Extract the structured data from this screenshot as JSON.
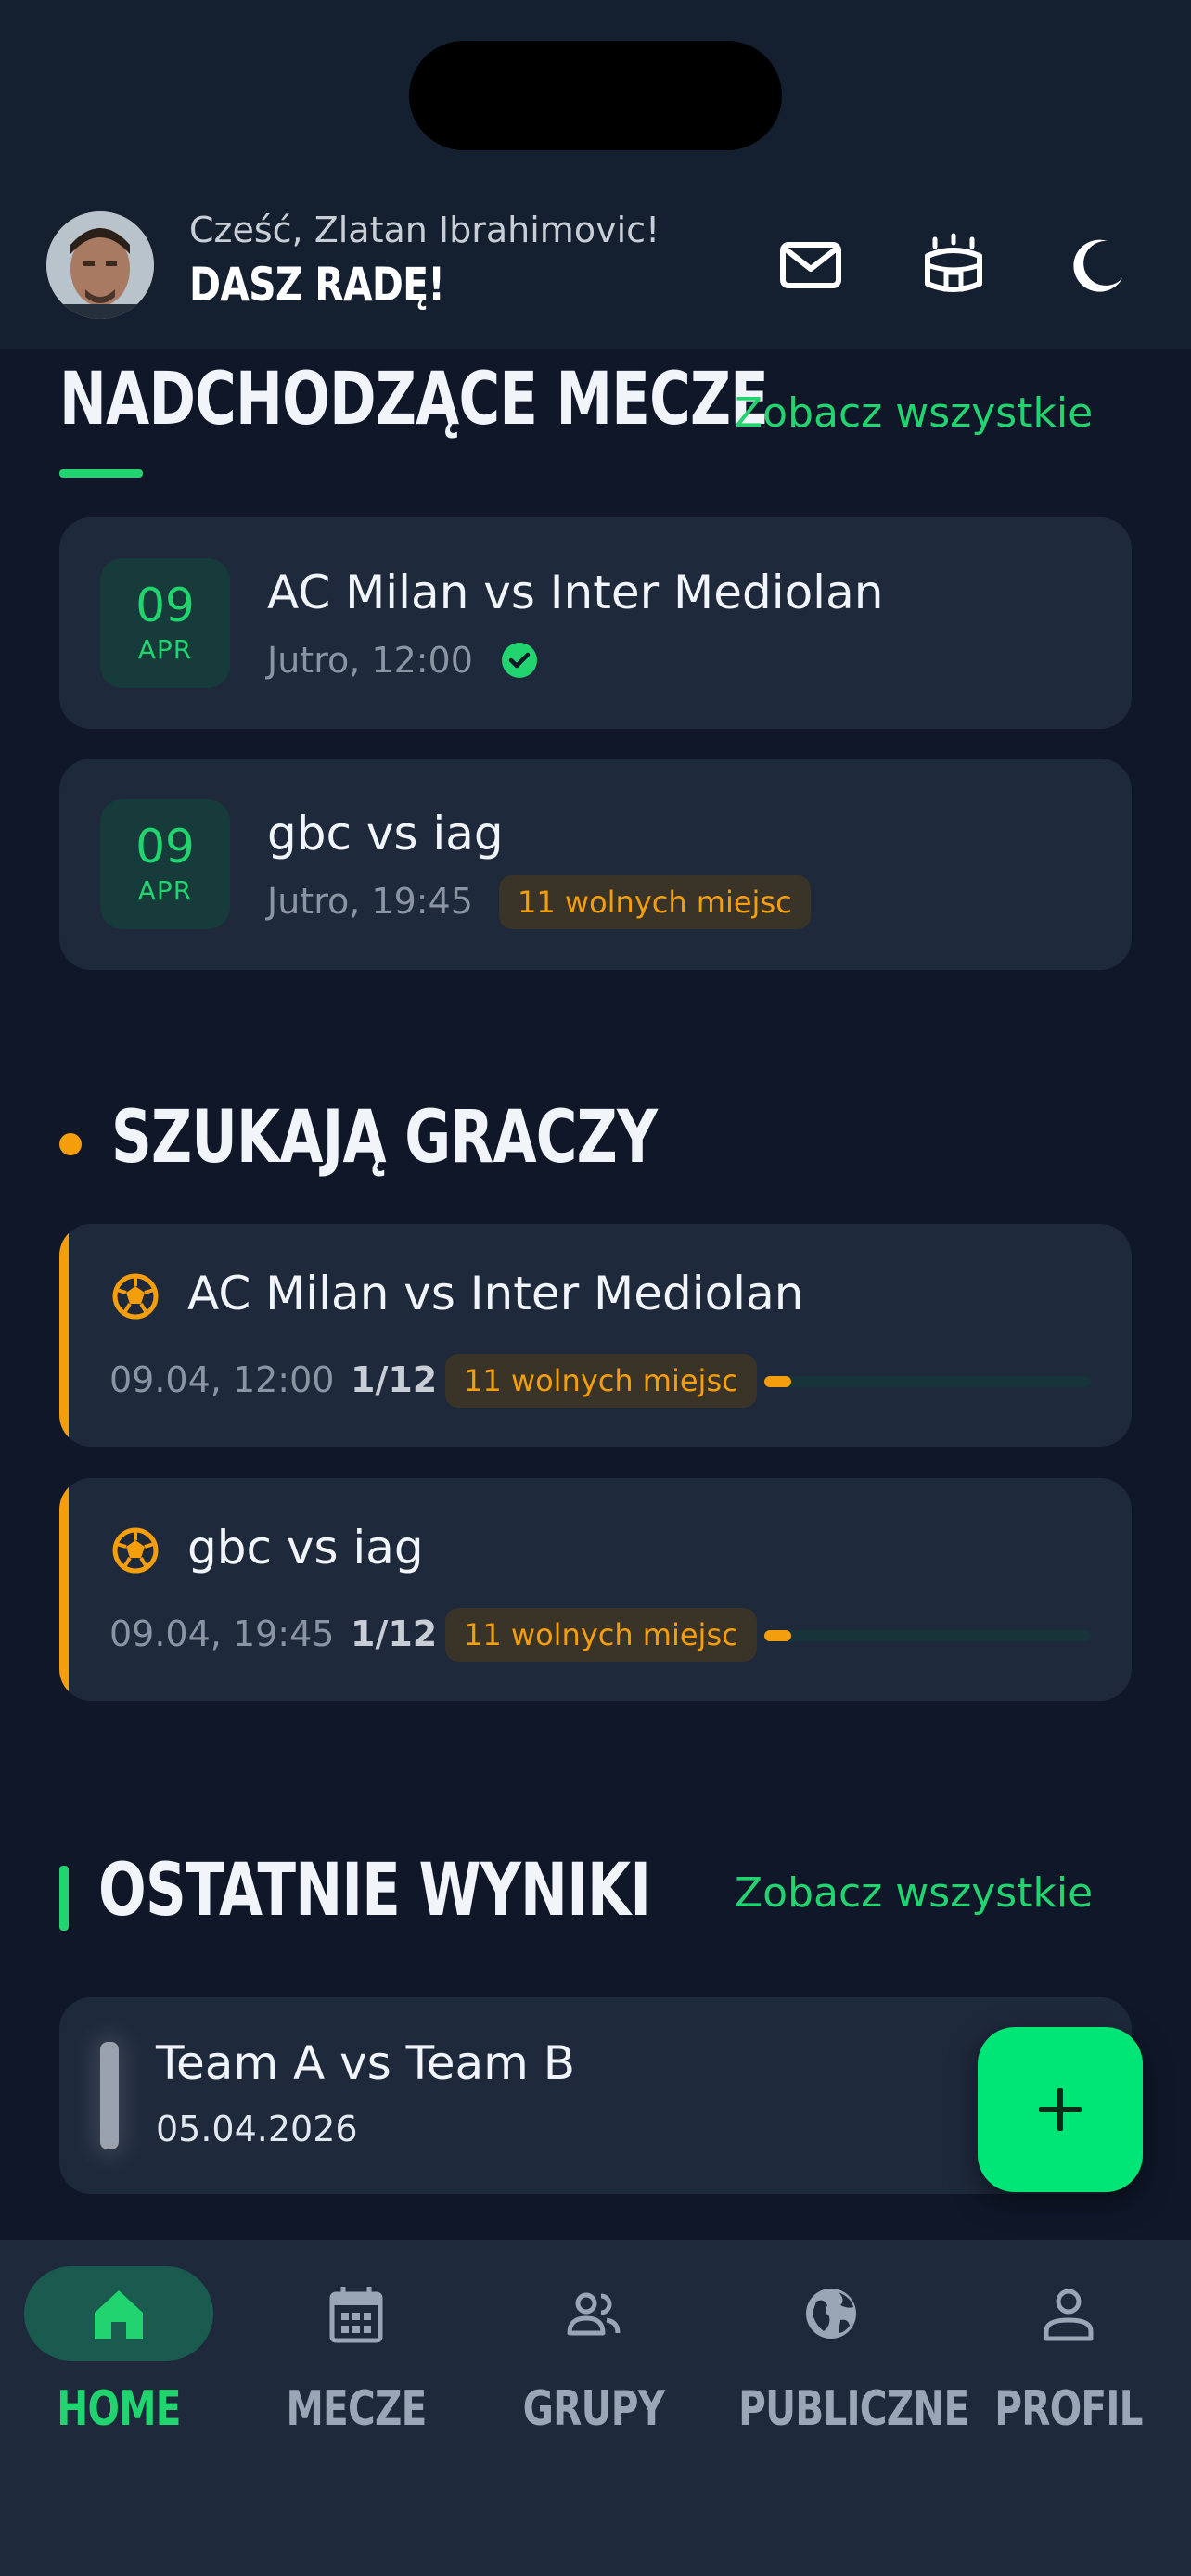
{
  "header": {
    "greeting": "Cześć, Zlatan Ibrahimovic!",
    "motto": "DASZ RADĘ!",
    "icons": [
      "mail-icon",
      "stadium-icon",
      "moon-icon"
    ]
  },
  "upcoming": {
    "title": "NADCHODZĄCE MECZE",
    "see_all": "Zobacz wszystkie",
    "matches": [
      {
        "day": "09",
        "month": "APR",
        "title": "AC Milan vs Inter Mediolan",
        "time": "Jutro, 12:00",
        "confirmed": true
      },
      {
        "day": "09",
        "month": "APR",
        "title": "gbc vs iag",
        "time": "Jutro, 19:45",
        "badge": "11 wolnych miejsc"
      }
    ]
  },
  "looking": {
    "title": "SZUKAJĄ GRACZY",
    "items": [
      {
        "title": "AC Milan vs Inter Mediolan",
        "date": "09.04, 12:00",
        "count": "1/12",
        "badge": "11 wolnych miejsc",
        "progress": 0.083
      },
      {
        "title": "gbc vs iag",
        "date": "09.04, 19:45",
        "count": "1/12",
        "badge": "11 wolnych miejsc",
        "progress": 0.083
      }
    ]
  },
  "results": {
    "title": "OSTATNIE WYNIKI",
    "see_all": "Zobacz wszystkie",
    "items": [
      {
        "title": "Team A vs Team B",
        "date": "05.04.2026"
      }
    ]
  },
  "fab": {
    "icon": "plus-icon"
  },
  "nav": {
    "items": [
      {
        "label": "HOME",
        "icon": "home-icon",
        "active": true
      },
      {
        "label": "MECZE",
        "icon": "calendar-icon"
      },
      {
        "label": "GRUPY",
        "icon": "group-icon"
      },
      {
        "label": "PUBLICZNE",
        "icon": "globe-icon"
      },
      {
        "label": "PROFIL",
        "icon": "person-icon"
      }
    ]
  },
  "colors": {
    "accent": "#22d46f",
    "warning": "#f59e0b",
    "background": "#0f1729",
    "card": "#1e293b"
  }
}
